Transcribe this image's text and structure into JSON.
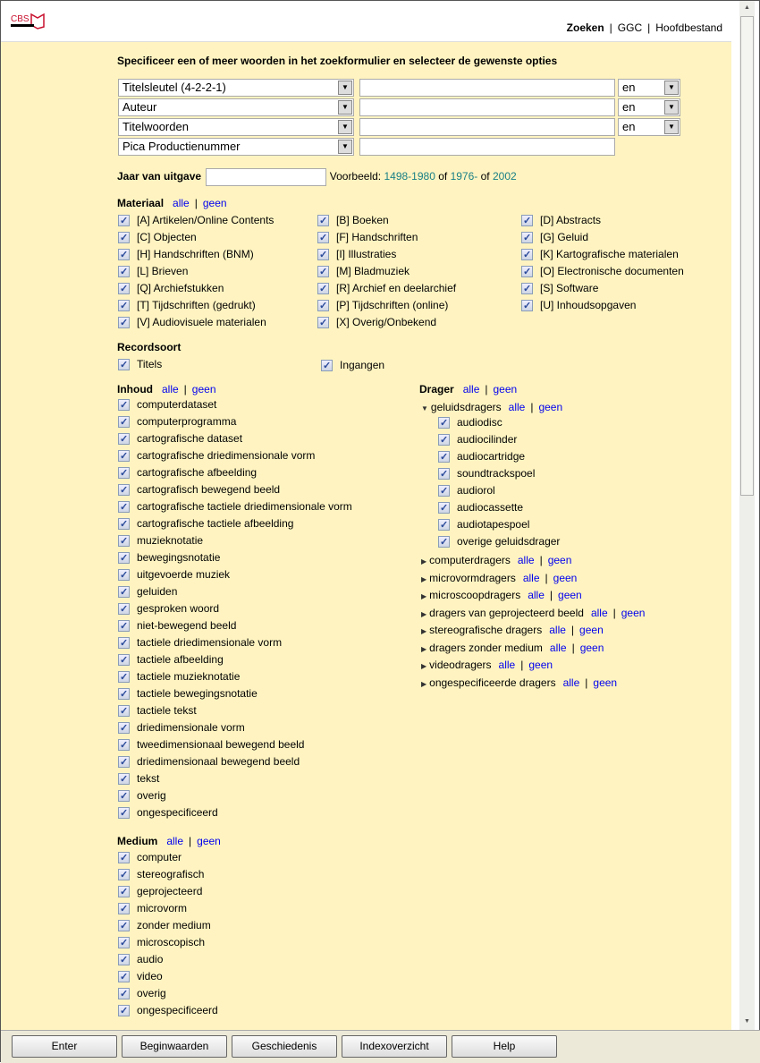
{
  "header": {
    "logo_text": "CBS",
    "nav": [
      "Zoeken",
      "GGC",
      "Hoofdbestand"
    ]
  },
  "intro": "Specificeer een of meer woorden in het zoekformulier en selecteer de gewenste opties",
  "search_rows": [
    {
      "field": "Titelsleutel (4-2-2-1)",
      "value": "",
      "op": "en"
    },
    {
      "field": "Auteur",
      "value": "",
      "op": "en"
    },
    {
      "field": "Titelwoorden",
      "value": "",
      "op": "en"
    },
    {
      "field": "Pica Productienummer",
      "value": ""
    }
  ],
  "year": {
    "label": "Jaar van uitgave",
    "value": "",
    "example_prefix": "Voorbeeld:",
    "ex1": "1498-1980",
    "of1": "of",
    "ex2": "1976-",
    "of2": "of",
    "ex3": "2002"
  },
  "links": {
    "all": "alle",
    "none": "geen",
    "sep": "|"
  },
  "materiaal": {
    "title": "Materiaal",
    "columns": [
      [
        "[A] Artikelen/Online Contents",
        "[C] Objecten",
        "[H] Handschriften (BNM)",
        "[L] Brieven",
        "[Q] Archiefstukken",
        "[T] Tijdschriften (gedrukt)",
        "[V] Audiovisuele materialen"
      ],
      [
        "[B] Boeken",
        "[F] Handschriften",
        "[I] Illustraties",
        "[M] Bladmuziek",
        "[R] Archief en deelarchief",
        "[P] Tijdschriften (online)",
        "[X] Overig/Onbekend"
      ],
      [
        "[D] Abstracts",
        "[G] Geluid",
        "[K] Kartografische materialen",
        "[O] Electronische documenten",
        "[S] Software",
        "[U] Inhoudsopgaven"
      ]
    ]
  },
  "recordsoort": {
    "title": "Recordsoort",
    "items": [
      "Titels",
      "Ingangen"
    ]
  },
  "inhoud": {
    "title": "Inhoud",
    "items": [
      "computerdataset",
      "computerprogramma",
      "cartografische dataset",
      "cartografische driedimensionale vorm",
      "cartografische afbeelding",
      "cartografisch bewegend beeld",
      "cartografische tactiele driedimensionale vorm",
      "cartografische tactiele afbeelding",
      "muzieknotatie",
      "bewegingsnotatie",
      "uitgevoerde muziek",
      "geluiden",
      "gesproken woord",
      "niet-bewegend beeld",
      "tactiele driedimensionale vorm",
      "tactiele afbeelding",
      "tactiele muzieknotatie",
      "tactiele bewegingsnotatie",
      "tactiele tekst",
      "driedimensionale vorm",
      "tweedimensionaal bewegend beeld",
      "driedimensionaal bewegend beeld",
      "tekst",
      "overig",
      "ongespecificeerd"
    ]
  },
  "medium": {
    "title": "Medium",
    "items": [
      "computer",
      "stereografisch",
      "geprojecteerd",
      "microvorm",
      "zonder medium",
      "microscopisch",
      "audio",
      "video",
      "overig",
      "ongespecificeerd"
    ]
  },
  "drager": {
    "title": "Drager",
    "expanded": {
      "label": "geluidsdragers",
      "items": [
        "audiodisc",
        "audiocilinder",
        "audiocartridge",
        "soundtrackspoel",
        "audiorol",
        "audiocassette",
        "audiotapespoel",
        "overige geluidsdrager"
      ]
    },
    "collapsed": [
      "computerdragers",
      "microvormdragers",
      "microscoopdragers",
      "dragers van geprojecteerd beeld",
      "stereografische dragers",
      "dragers zonder medium",
      "videodragers",
      "ongespecificeerde dragers"
    ]
  },
  "buttons": [
    "Enter",
    "Beginwaarden",
    "Geschiedenis",
    "Indexoverzicht",
    "Help"
  ],
  "colors": {
    "background": "#fff4c1",
    "link": "#0000ee",
    "example": "#1a7f86",
    "logo": "#c8102e"
  }
}
